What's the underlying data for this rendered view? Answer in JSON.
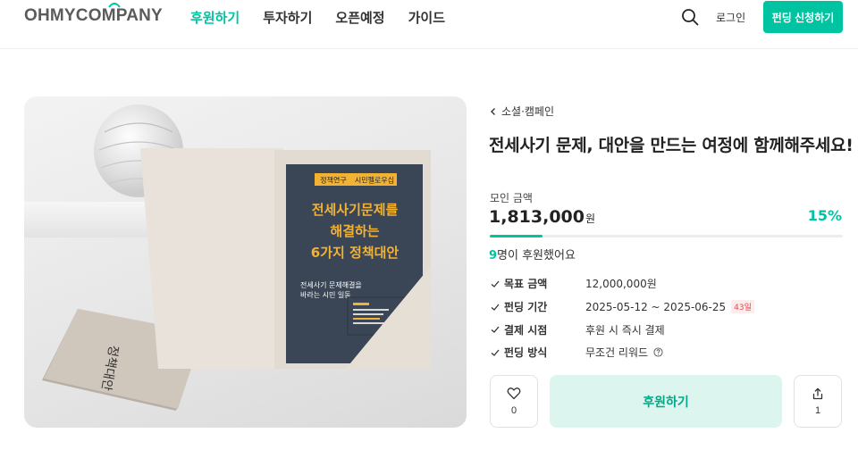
{
  "header": {
    "logo": "OHMYCOMPANY",
    "nav": [
      {
        "label": "후원하기",
        "active": true
      },
      {
        "label": "투자하기",
        "active": false
      },
      {
        "label": "오픈예정",
        "active": false
      },
      {
        "label": "가이드",
        "active": false
      }
    ],
    "search_icon": "search-icon",
    "login_label": "로그인",
    "apply_label": "펀딩 신청하기"
  },
  "media": {
    "tag_left": "정책연구",
    "tag_right": "시민펠로우십",
    "headline_lines": [
      "전세사기문제를",
      "해결하는",
      "6가지 정책대안"
    ],
    "sub_lines": [
      "전세사기 문제해결을",
      "바라는 시민 일동"
    ]
  },
  "project": {
    "breadcrumb": "소셜·캠페인",
    "title": "전세사기 문제, 대안을 만드는 여정에 함께해주세요!",
    "raised_label": "모인 금액",
    "raised_amount": "1,813,000",
    "raised_unit": "원",
    "percent": "15%",
    "progress_fraction": 0.15,
    "backers_count": "9",
    "backers_text": "명이 후원했어요",
    "info": {
      "goal_label": "목표 금액",
      "goal_value": "12,000,000원",
      "period_label": "펀딩 기간",
      "period_value": "2025-05-12 ~ 2025-06-25",
      "period_badge": "43일",
      "payment_label": "결제 시점",
      "payment_value": "후원 시 즉시 결제",
      "method_label": "펀딩 방식",
      "method_value": "무조건 리워드"
    },
    "like_count": "0",
    "back_label": "후원하기",
    "share_count": "1"
  },
  "colors": {
    "accent": "#00c4a1",
    "accent_light": "#dcf6ef",
    "badge_red": "#e5484d",
    "cover_navy": "#3a4656",
    "cover_yellow": "#f2b233"
  }
}
